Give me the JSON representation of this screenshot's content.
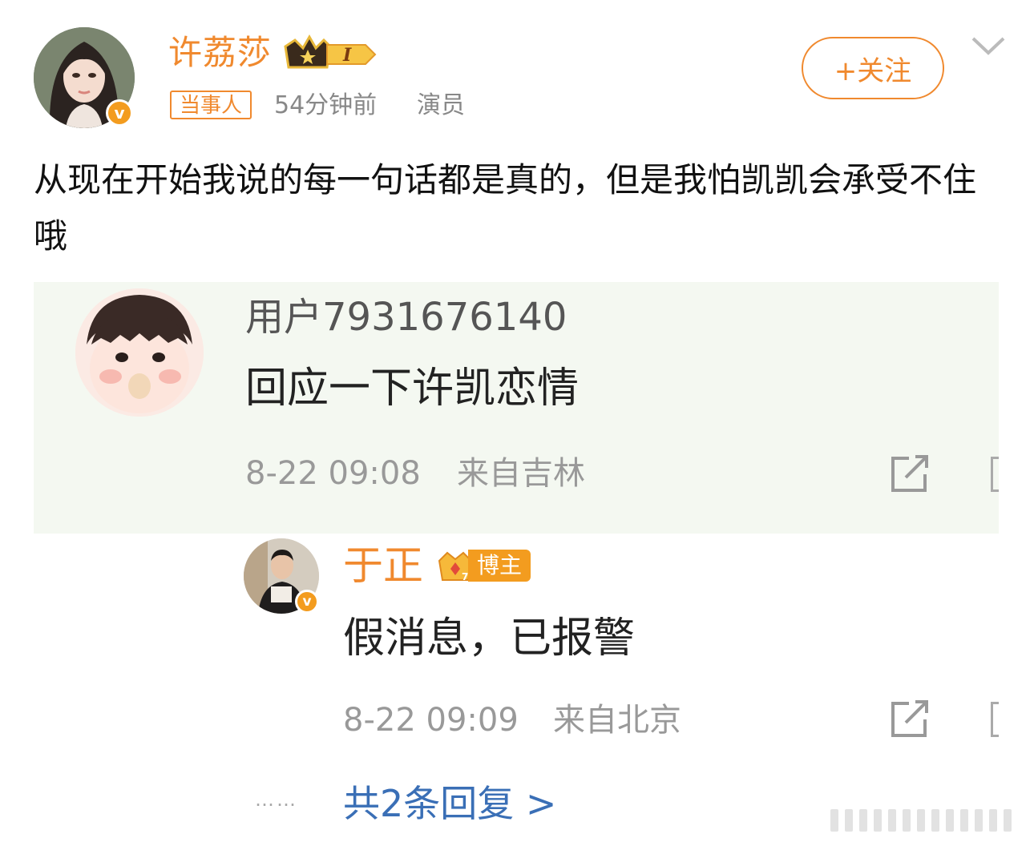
{
  "post": {
    "author_name": "许荔莎",
    "level_badge": "I",
    "tag": "当事人",
    "time": "54分钟前",
    "role": "演员",
    "follow_label": "+关注",
    "text": "从现在开始我说的每一句话都是真的，但是我怕凯凯会承受不住哦"
  },
  "comment": {
    "user": "用户7931676140",
    "text": "回应一下许凯恋情",
    "date": "8-22 09:08",
    "location": "来自吉林"
  },
  "reply": {
    "user": "于正",
    "badge_label": "博主",
    "text": "假消息，已报警",
    "date": "8-22 09:09",
    "location": "来自北京"
  },
  "more_replies": "共2条回复 >",
  "icons": {
    "verified": "verified-v-icon",
    "crown": "crown-level-icon",
    "chevron": "chevron-down-icon",
    "share": "share-edit-icon"
  },
  "colors": {
    "accent": "#f0892e",
    "link": "#3a6fb6",
    "embed_bg": "#f4f8f1"
  }
}
